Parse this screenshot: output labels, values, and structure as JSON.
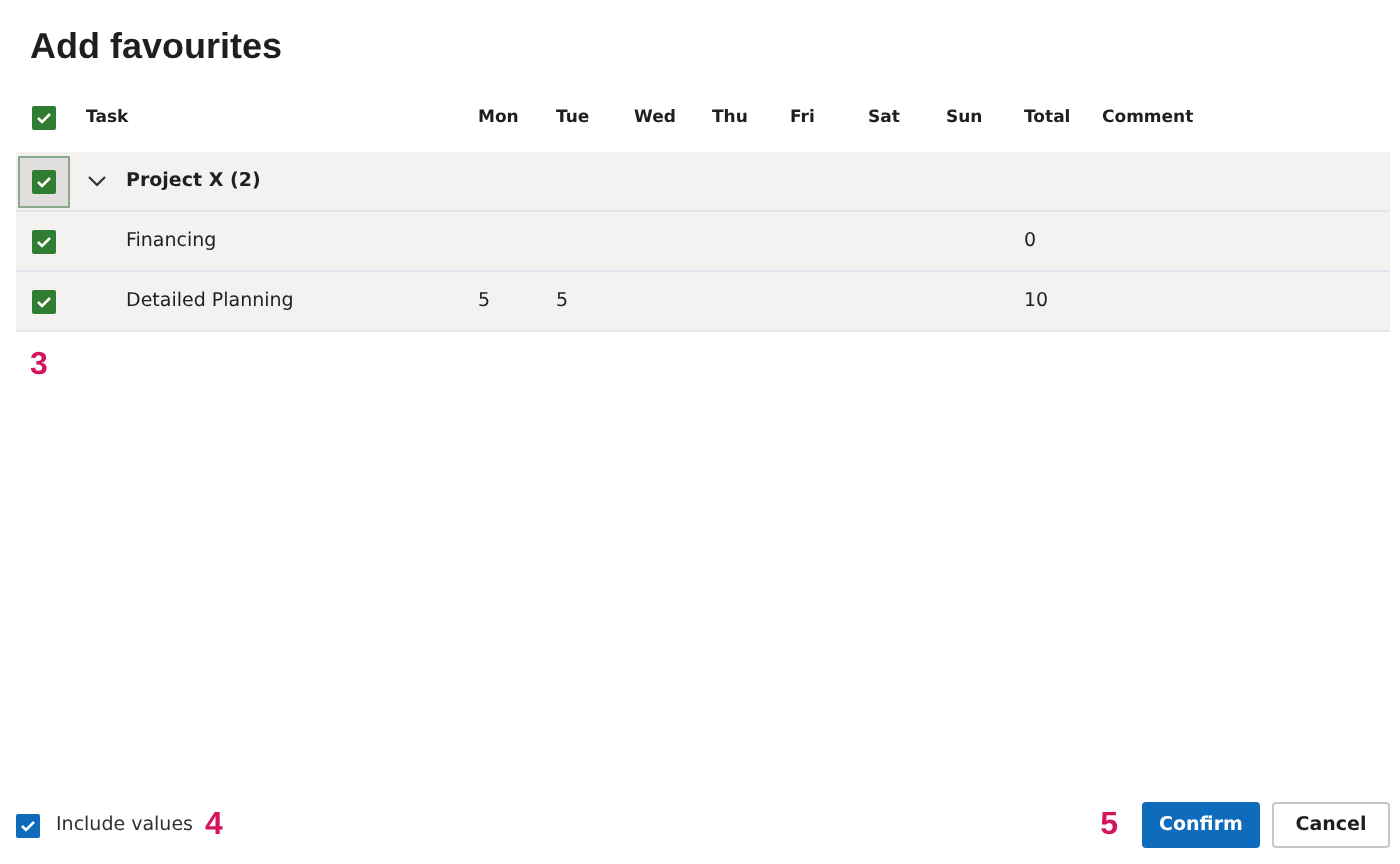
{
  "title": "Add favourites",
  "table": {
    "all_checked": true,
    "columns": [
      "Task",
      "Mon",
      "Tue",
      "Wed",
      "Thu",
      "Fri",
      "Sat",
      "Sun",
      "Total",
      "Comment"
    ],
    "groups": [
      {
        "label": "Project X (2)",
        "checked": true,
        "expanded": true,
        "focused": true,
        "children": [
          {
            "checked": true,
            "cells": [
              "Financing",
              "",
              "",
              "",
              "",
              "",
              "",
              "",
              "0",
              ""
            ]
          },
          {
            "checked": true,
            "cells": [
              "Detailed Planning",
              "5",
              "5",
              "",
              "",
              "",
              "",
              "",
              "10",
              ""
            ]
          }
        ]
      }
    ]
  },
  "callouts": [
    "3",
    "4",
    "5"
  ],
  "footer": {
    "include_values": {
      "label": "Include values",
      "checked": true
    },
    "buttons": [
      {
        "label": "Confirm",
        "kind": "primary"
      },
      {
        "label": "Cancel",
        "kind": "secondary"
      }
    ]
  }
}
